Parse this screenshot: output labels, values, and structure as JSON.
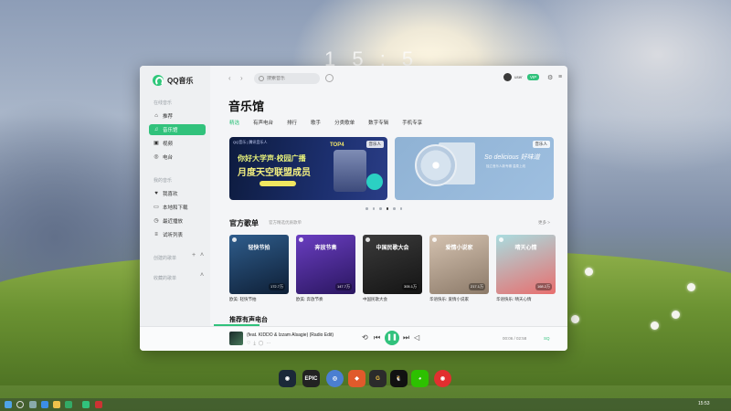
{
  "desktop": {
    "clock": "1 5 : 5"
  },
  "app": {
    "name": "QQ音乐"
  },
  "sidebar": {
    "section_online": "在线音乐",
    "items_online": [
      {
        "label": "推荐",
        "icon": "home-icon"
      },
      {
        "label": "音乐馆",
        "icon": "music-note-icon"
      },
      {
        "label": "视频",
        "icon": "video-icon"
      },
      {
        "label": "电台",
        "icon": "radio-icon"
      }
    ],
    "section_mine": "我的音乐",
    "items_mine": [
      {
        "label": "我喜欢",
        "icon": "heart-icon"
      },
      {
        "label": "本地和下载",
        "icon": "computer-icon"
      },
      {
        "label": "最近播放",
        "icon": "clock-icon"
      },
      {
        "label": "试听列表",
        "icon": "list-icon"
      }
    ],
    "created_playlists": "创建的歌单",
    "collected_playlists": "收藏的歌单"
  },
  "topbar": {
    "search_placeholder": "搜索音乐",
    "username": "user",
    "vip_badge": "VIP"
  },
  "page": {
    "title": "音乐馆",
    "tabs": [
      "精选",
      "有声电台",
      "排行",
      "歌手",
      "分类歌单",
      "数字专辑",
      "手机专享"
    ],
    "active_tab": 0
  },
  "banners": [
    {
      "tag": "音乐人",
      "header": "QQ音乐 | 腾讯音乐人",
      "headline": "你好大学声·校园广播",
      "subheadline": "月度天空联盟成员",
      "badge": "TOP4"
    },
    {
      "tag": "音乐人",
      "title": "So delicious 好味道",
      "subtitle": "独立音乐人新专辑 温柔上线"
    }
  ],
  "carousel": {
    "count": 6,
    "active": 3
  },
  "official_playlists": {
    "title": "官方歌单",
    "desc": "官方精选优质歌单",
    "more": "更多 >",
    "items": [
      {
        "cover_label": "轻快节拍",
        "count": "172.7万",
        "name": "欧美: 轻快节拍",
        "color1": "#2f5d8c",
        "color2": "#0e1f36"
      },
      {
        "cover_label": "奔放节奏",
        "count": "147.7万",
        "name": "欧美: 奔放节奏",
        "color1": "#6a3ec1",
        "color2": "#2a1660"
      },
      {
        "cover_label": "中国民歌大会",
        "count": "305.1万",
        "name": "中国民歌大会",
        "color1": "#3b3b3b",
        "color2": "#141414"
      },
      {
        "cover_label": "爱情小说家",
        "count": "217.1万",
        "name": "华语快乐: 爱情小说家",
        "color1": "#d4c2b0",
        "color2": "#8c7a69"
      },
      {
        "cover_label": "晴天心情",
        "count": "168.2万",
        "name": "华语快乐: 晴天心情",
        "color1": "#a9dde0",
        "color2": "#e86e6e"
      }
    ]
  },
  "next_section": {
    "title": "推荐有声电台"
  },
  "player": {
    "track": "(feat. KIDDO & Izzam Alsagie) (Radio Edit)",
    "time": "00:06 / 02:58",
    "quality": "SQ"
  },
  "taskbar": {
    "time": "15:53"
  }
}
